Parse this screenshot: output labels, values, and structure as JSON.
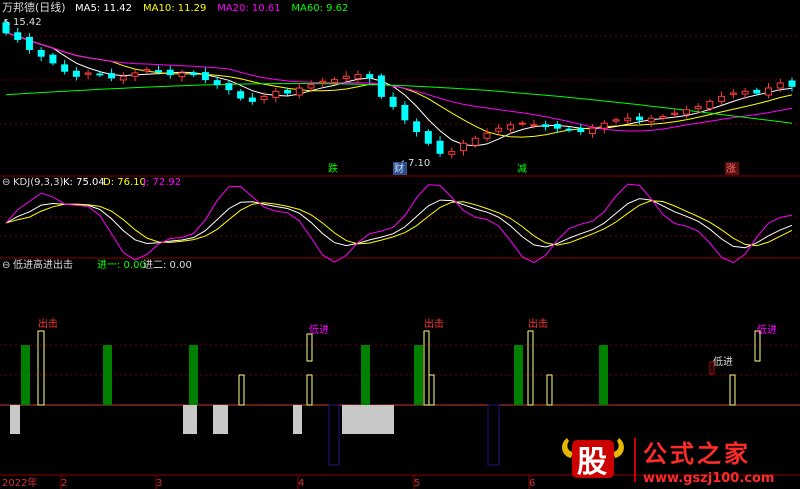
{
  "colors": {
    "bg": "#000000",
    "grid_red": "#8b0000",
    "up": "#ff3b3b",
    "down": "#00ffff",
    "ma5": "#ffffff",
    "ma10": "#ffff00",
    "ma20": "#ff00ff",
    "ma60": "#00ff00",
    "k": "#ffffff",
    "d": "#ffff00",
    "j": "#ff00ff",
    "bar_green": "#008000",
    "bar_outline": "#ffff80",
    "bar_gray": "#c8c8c8",
    "bar_navy": "#1a1a80",
    "chuji": "#ff3333",
    "dijin": "#ff00ff"
  },
  "main": {
    "stock_name": "万邦德(日线)",
    "ma_labels": [
      {
        "name": "MA5",
        "value": "11.42",
        "color": "#ffffff"
      },
      {
        "name": "MA10",
        "value": "11.29",
        "color": "#ffff00"
      },
      {
        "name": "MA20",
        "value": "10.61",
        "color": "#ff00ff"
      },
      {
        "name": "MA60",
        "value": "9.62",
        "color": "#00ff00"
      }
    ],
    "high_label": "15.42",
    "low_label": "7.10",
    "event_tags": [
      {
        "label": "跌",
        "color": "#00ff00"
      },
      {
        "label": "财",
        "color": "#4fa4ff"
      },
      {
        "label": "减",
        "color": "#00ff00"
      },
      {
        "label": "涨",
        "color": "#ff3b3b"
      }
    ]
  },
  "kdj": {
    "title": "KDJ(9,3,3)",
    "k_label": "K: 75.04",
    "d_label": "D: 76.10",
    "j_label": "J: 72.92"
  },
  "signal": {
    "title": "低进高进出击",
    "item1": "进一: 0.00",
    "item2": "进二: 0.00",
    "annotations": [
      "出击",
      "低进",
      "出击",
      "出击",
      "低进",
      "低进"
    ]
  },
  "x_axis": {
    "labels": [
      "2022年",
      "2",
      "3",
      "4",
      "5",
      "6"
    ]
  },
  "watermark": {
    "logo_char": "股",
    "brand": "公式之家",
    "url": "www.gszj100.com"
  },
  "chart_data": [
    {
      "type": "candlestick",
      "name": "万邦德(日线)",
      "x_axis_labels": [
        "2022年",
        "2",
        "3",
        "4",
        "5",
        "6"
      ],
      "close_approx": [
        14.6,
        14.2,
        13.6,
        13.2,
        12.8,
        12.3,
        12.0,
        12.2,
        12.1,
        11.9,
        12.0,
        12.2,
        12.4,
        12.3,
        12.1,
        12.2,
        12.1,
        11.8,
        11.5,
        11.2,
        10.7,
        10.5,
        10.8,
        11.1,
        11.0,
        11.3,
        11.5,
        11.7,
        11.8,
        12.0,
        12.1,
        11.9,
        10.8,
        10.2,
        9.4,
        8.7,
        8.0,
        7.4,
        7.5,
        8.0,
        8.3,
        8.6,
        8.9,
        9.1,
        9.2,
        9.1,
        9.0,
        8.9,
        8.8,
        8.7,
        8.9,
        9.2,
        9.4,
        9.5,
        9.4,
        9.5,
        9.6,
        9.8,
        10.0,
        10.2,
        10.5,
        10.8,
        11.0,
        11.1,
        11.0,
        11.3,
        11.6,
        11.4
      ],
      "high_marker": 15.42,
      "low_marker": 7.1,
      "moving_averages": {
        "MA5": 11.42,
        "MA10": 11.29,
        "MA20": 10.61,
        "MA60": 9.62
      }
    },
    {
      "type": "line",
      "name": "KDJ(9,3,3)",
      "series": [
        {
          "name": "K",
          "last": 75.04
        },
        {
          "name": "D",
          "last": 76.1
        },
        {
          "name": "J",
          "last": 72.92
        }
      ]
    },
    {
      "type": "bar",
      "name": "低进高进出击",
      "series": [
        {
          "name": "进一",
          "last": 0.0
        },
        {
          "name": "进二",
          "last": 0.0
        }
      ]
    }
  ]
}
